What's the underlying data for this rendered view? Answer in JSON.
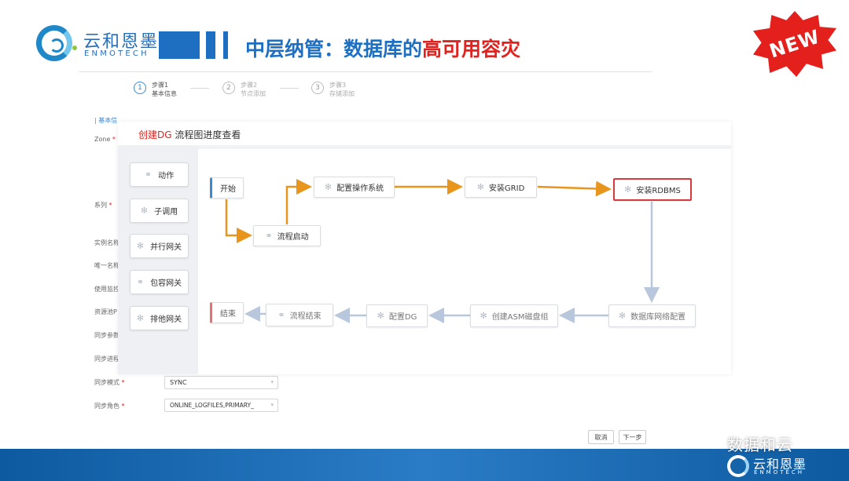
{
  "header": {
    "logo_cn": "云和恩墨",
    "logo_en": "ENMOTECH",
    "title_prefix": "中层纳管：数据库的",
    "title_highlight": "高可用容灾",
    "badge": "NEW"
  },
  "steps": [
    {
      "num": "1",
      "label": "步骤1",
      "sub": "基本信息"
    },
    {
      "num": "2",
      "label": "步骤2",
      "sub": "节点添加"
    },
    {
      "num": "3",
      "label": "步骤3",
      "sub": "存储添加"
    }
  ],
  "form": {
    "section": "基本信",
    "labels": {
      "zone": "Zone",
      "series": "系列",
      "instance_name": "实例名称",
      "unique_name": "唯一名称",
      "monitor": "使用监控",
      "resource_pool": "资源池P",
      "sync_param": "同步参数",
      "sync_process": "同步进程",
      "sync_mode": "同步模式",
      "sync_role": "同步角色"
    },
    "sync_mode_value": "SYNC",
    "sync_role_value": "ONLINE_LOGFILES,PRIMARY_",
    "cancel": "取消",
    "next": "下一步"
  },
  "modal": {
    "title_highlight": "创建DG",
    "title_rest": " 流程图进度查看"
  },
  "palette": [
    {
      "label": "动作",
      "icon": "link-icon"
    },
    {
      "label": "子调用",
      "icon": "spinner-icon"
    },
    {
      "label": "并行网关",
      "icon": "spinner-icon"
    },
    {
      "label": "包容网关",
      "icon": "link-icon"
    },
    {
      "label": "排他网关",
      "icon": "spinner-icon"
    }
  ],
  "flow": {
    "start": "开始",
    "process_start": "流程启动",
    "config_os": "配置操作系统",
    "install_grid": "安装GRID",
    "install_rdbms": "安装RDBMS",
    "db_network": "数据库网络配置",
    "create_asm": "创建ASM磁盘组",
    "config_dg": "配置DG",
    "process_end": "流程结束",
    "end": "结束"
  },
  "colors": {
    "accent_blue": "#1e6fc2",
    "accent_red": "#e0231f",
    "flow_done": "#e8951d",
    "flow_pending": "#b8c7db"
  },
  "watermark": "数据和云",
  "footer": {
    "logo_cn": "云和恩墨",
    "logo_en": "ENMOTECH"
  }
}
